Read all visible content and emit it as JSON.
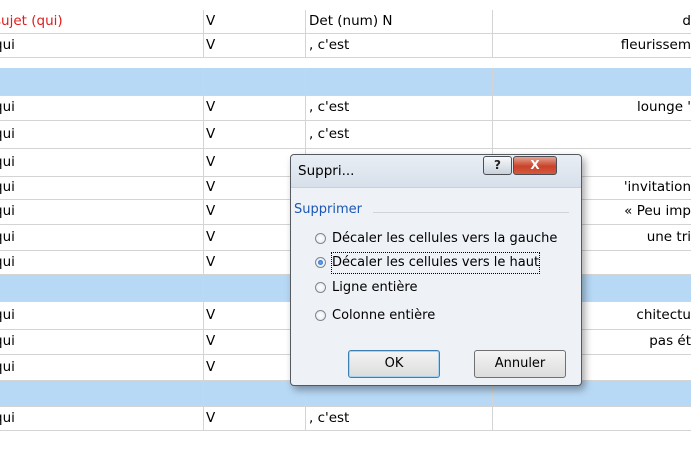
{
  "sheet": {
    "rows": [
      {
        "c1": "sujet (qui)",
        "c2": "V",
        "c3": "Det (num) N",
        "c4": "d",
        "blue": false,
        "red": true
      },
      {
        "c1": "qui",
        "c2": "V",
        "c3": ", c'est",
        "c4": "fleurissem",
        "blue": false
      },
      {
        "c1": "",
        "c2": "",
        "c3": "",
        "c4": "",
        "blue": true
      },
      {
        "c1": "qui",
        "c2": "V",
        "c3": ", c'est",
        "c4": "lounge '",
        "blue": false
      },
      {
        "c1": "qui",
        "c2": "V",
        "c3": ", c'est",
        "c4": "",
        "blue": false
      },
      {
        "c1": "qui",
        "c2": "V",
        "c3": "",
        "c4": "",
        "blue": false
      },
      {
        "c1": "qui",
        "c2": "V",
        "c3": "",
        "c4": "'invitation",
        "blue": false
      },
      {
        "c1": "qui",
        "c2": "V",
        "c3": "",
        "c4": "« Peu imp",
        "blue": false
      },
      {
        "c1": "qui",
        "c2": "V",
        "c3": "",
        "c4": "une tri",
        "blue": false
      },
      {
        "c1": "qui",
        "c2": "V",
        "c3": "",
        "c4": "",
        "blue": false
      },
      {
        "c1": "",
        "c2": "",
        "c3": "",
        "c4": "",
        "blue": true
      },
      {
        "c1": "qui",
        "c2": "V",
        "c3": "",
        "c4": "chitectu",
        "blue": false
      },
      {
        "c1": "qui",
        "c2": "V",
        "c3": "",
        "c4": "pas ét",
        "blue": false
      },
      {
        "c1": "qui",
        "c2": "V",
        "c3": "",
        "c4": "",
        "blue": false
      },
      {
        "c1": "",
        "c2": "",
        "c3": "",
        "c4": "",
        "blue": true
      },
      {
        "c1": "qui",
        "c2": "V",
        "c3": ", c'est",
        "c4": "",
        "blue": false
      }
    ]
  },
  "dialog": {
    "title": "Suppri...",
    "help_label": "?",
    "close_label": "X",
    "group_label": "Supprimer",
    "options": [
      {
        "label": "Décaler les cellules vers la gauche",
        "checked": false
      },
      {
        "label": "Décaler les cellules vers le haut",
        "checked": true
      },
      {
        "label": "Ligne entière",
        "checked": false
      },
      {
        "label": "Colonne entière",
        "checked": false
      }
    ],
    "ok_label": "OK",
    "cancel_label": "Annuler"
  },
  "colors": {
    "selection_band": "#b8d9f6",
    "header_red": "#e11b1b",
    "group_blue": "#1b57b5"
  }
}
